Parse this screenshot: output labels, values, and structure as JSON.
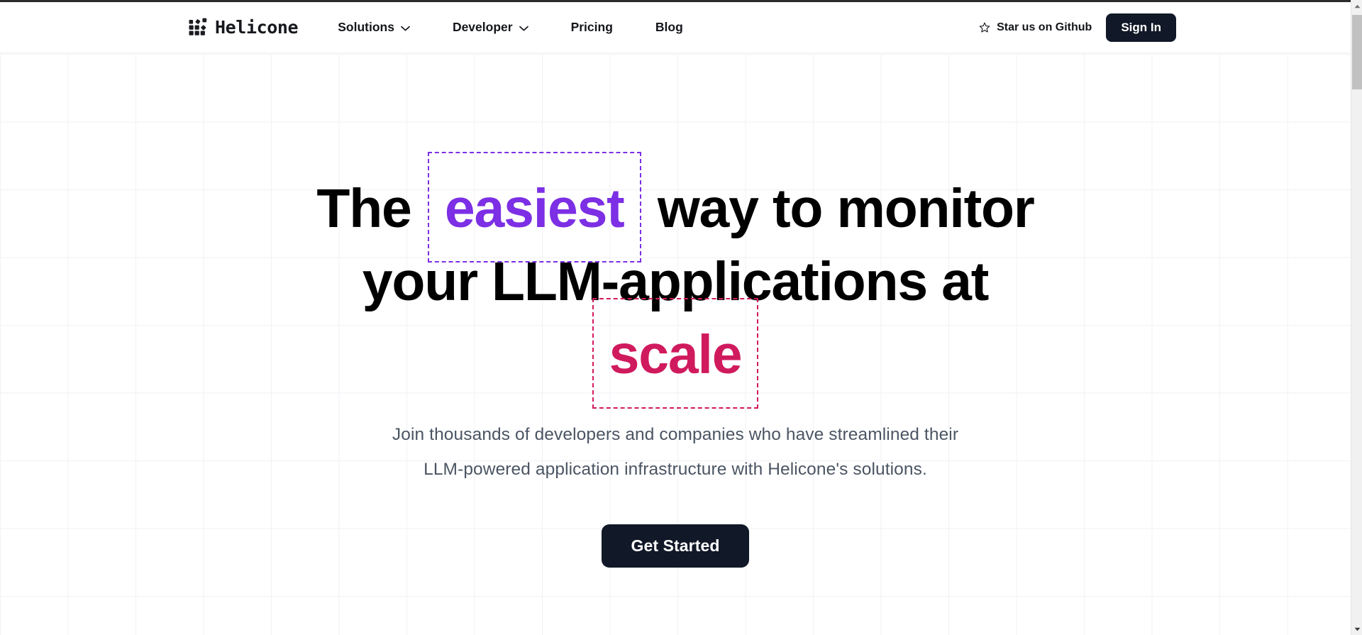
{
  "header": {
    "logo": {
      "name": "Helicone",
      "mark_icon": "dots-grid-icon"
    },
    "nav": [
      {
        "label": "Solutions",
        "has_dropdown": true,
        "icon": "chevron-down-icon"
      },
      {
        "label": "Developer",
        "has_dropdown": true,
        "icon": "chevron-down-icon"
      },
      {
        "label": "Pricing",
        "has_dropdown": false
      },
      {
        "label": "Blog",
        "has_dropdown": false
      }
    ],
    "github": {
      "label": "Star us on Github",
      "icon": "star-icon"
    },
    "signin_label": "Sign In"
  },
  "hero": {
    "headline": {
      "line1_pre": "The",
      "line1_highlight": "easiest",
      "line1_post": "way to monitor",
      "line2": "your LLM-applications at",
      "line3_highlight": "scale"
    },
    "subtitle": {
      "line1": "Join thousands of developers and companies who have streamlined their",
      "line2": "LLM-powered application infrastructure with Helicone's solutions."
    },
    "cta_label": "Get Started"
  },
  "scrollbar": {
    "up_icon": "scroll-up-arrow-icon",
    "down_icon": "scroll-down-arrow-icon",
    "thumb": "scrollbar-thumb"
  },
  "colors": {
    "purple_accent": "#7c2fe4",
    "crimson_accent": "#d01a5e",
    "dark_button": "#111827",
    "subtitle_text": "#4b5563",
    "grid_line": "#f1f2f4"
  }
}
